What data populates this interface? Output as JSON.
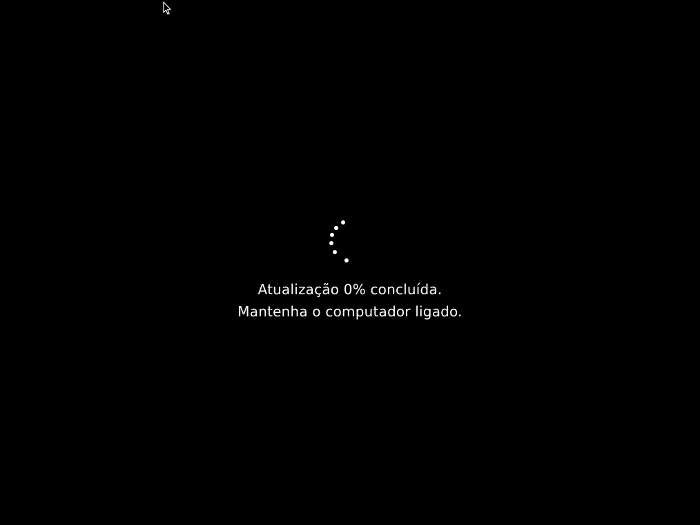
{
  "update_screen": {
    "progress_line": "Atualização 0% concluída.",
    "instruction_line": "Mantenha o computador ligado.",
    "progress_percent": 0
  },
  "colors": {
    "background": "#000000",
    "text": "#ffffff",
    "spinner_dots": "#ffffff"
  },
  "icons": {
    "cursor": "mouse-pointer-icon",
    "spinner": "loading-spinner-icon"
  }
}
